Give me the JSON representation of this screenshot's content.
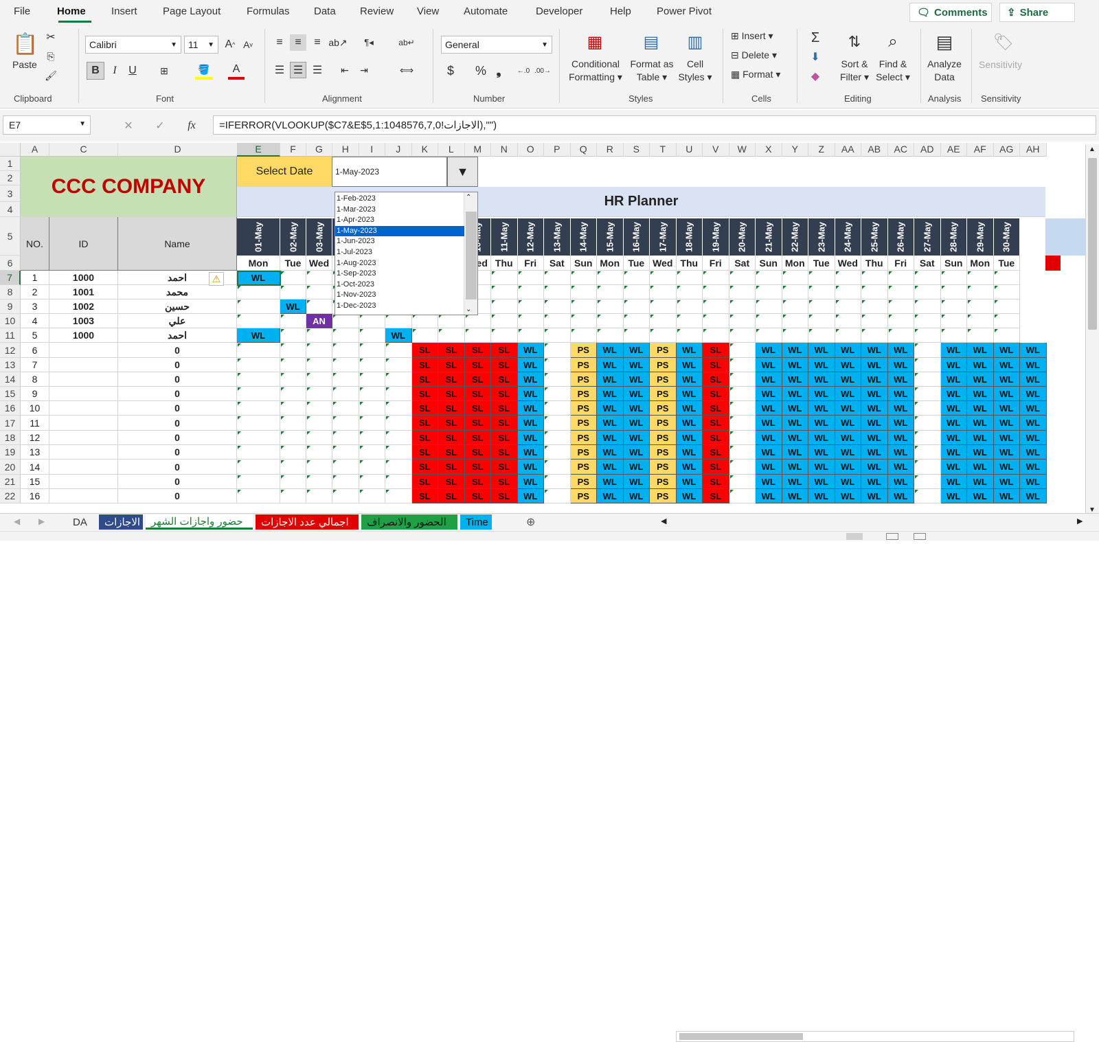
{
  "menu": {
    "items": [
      "File",
      "Home",
      "Insert",
      "Page Layout",
      "Formulas",
      "Data",
      "Review",
      "View",
      "Automate",
      "Developer",
      "Help",
      "Power Pivot"
    ],
    "comments": "Comments",
    "share": "Share"
  },
  "ribbon": {
    "paste": "Paste",
    "font_name": "Calibri",
    "font_size": "11",
    "number_format": "General",
    "conditional": "Conditional Formatting ▾",
    "format_table": "Format as Table ▾",
    "cell_styles": "Cell Styles ▾",
    "insert": "Insert",
    "delete": "Delete",
    "format": "Format",
    "sort_filter": "Sort & Filter ▾",
    "find_select": "Find & Select ▾",
    "analyze": "Analyze Data",
    "sensitivity": "Sensitivity",
    "groups": [
      "Clipboard",
      "Font",
      "Alignment",
      "Number",
      "Styles",
      "Cells",
      "Editing",
      "Analysis",
      "Sensitivity"
    ]
  },
  "formula_bar": {
    "name_box": "E7",
    "formula": "=IFERROR(VLOOKUP($C7&E$5,الاجازات!1:1048576,7,0),\"\")"
  },
  "columns": [
    "A",
    "C",
    "D",
    "E",
    "F",
    "G",
    "H",
    "I",
    "J",
    "K",
    "L",
    "M",
    "N",
    "O",
    "P",
    "Q",
    "R",
    "S",
    "T",
    "U",
    "V",
    "W",
    "X",
    "Y",
    "Z",
    "AA",
    "AB",
    "AC",
    "AD",
    "AE",
    "AF",
    "AG",
    "AH"
  ],
  "rows": [
    "1",
    "2",
    "3",
    "4",
    "5",
    "6",
    "7",
    "8",
    "9",
    "10",
    "11",
    "12",
    "13",
    "14",
    "15",
    "16",
    "17",
    "18",
    "19",
    "20",
    "21",
    "22"
  ],
  "sheet": {
    "company": "CCC COMPANY",
    "select_date_label": "Select Date",
    "selected_date": "1-May-2023",
    "planner_title": "HR Planner",
    "hdr_no": "NO.",
    "hdr_id": "ID",
    "hdr_name": "Name",
    "dates": [
      "01-May",
      "02-May",
      "03-May",
      "",
      "",
      "",
      "",
      "",
      "10-May",
      "11-May",
      "12-May",
      "13-May",
      "14-May",
      "15-May",
      "16-May",
      "17-May",
      "18-May",
      "19-May",
      "20-May",
      "21-May",
      "22-May",
      "23-May",
      "24-May",
      "25-May",
      "26-May",
      "27-May",
      "28-May",
      "29-May",
      "30-May"
    ],
    "days": [
      "Mon",
      "Tue",
      "Wed",
      "",
      "",
      "",
      "",
      "ue",
      "Wed",
      "Thu",
      "Fri",
      "Sat",
      "Sun",
      "Mon",
      "Tue",
      "Wed",
      "Thu",
      "Fri",
      "Sat",
      "Sun",
      "Mon",
      "Tue",
      "Wed",
      "Thu",
      "Fri",
      "Sat",
      "Sun",
      "Mon",
      "Tue"
    ],
    "employees": [
      {
        "no": "1",
        "id": "1000",
        "name": "احمد"
      },
      {
        "no": "2",
        "id": "1001",
        "name": "محمد"
      },
      {
        "no": "3",
        "id": "1002",
        "name": "حسين"
      },
      {
        "no": "4",
        "id": "1003",
        "name": "علي"
      },
      {
        "no": "5",
        "id": "1000",
        "name": "احمد"
      },
      {
        "no": "6",
        "id": "",
        "name": "0"
      },
      {
        "no": "7",
        "id": "",
        "name": "0"
      },
      {
        "no": "8",
        "id": "",
        "name": "0"
      },
      {
        "no": "9",
        "id": "",
        "name": "0"
      },
      {
        "no": "10",
        "id": "",
        "name": "0"
      },
      {
        "no": "11",
        "id": "",
        "name": "0"
      },
      {
        "no": "12",
        "id": "",
        "name": "0"
      },
      {
        "no": "13",
        "id": "",
        "name": "0"
      },
      {
        "no": "14",
        "id": "",
        "name": "0"
      },
      {
        "no": "15",
        "id": "",
        "name": "0"
      },
      {
        "no": "16",
        "id": "",
        "name": "0"
      }
    ],
    "leave_codes": {
      "WL": "#00b0f0",
      "SL": "#ff0000",
      "PS": "#ffd966",
      "AN": "#7030a0"
    },
    "dropdown_options": [
      "1-Feb-2023",
      "1-Mar-2023",
      "1-Apr-2023",
      "1-May-2023",
      "1-Jun-2023",
      "1-Jul-2023",
      "1-Aug-2023",
      "1-Sep-2023",
      "1-Oct-2023",
      "1-Nov-2023",
      "1-Dec-2023"
    ],
    "dropdown_selected": "1-May-2023"
  },
  "tabs": [
    {
      "label": "DA",
      "color": "#f3f3f3",
      "text": "#333"
    },
    {
      "label": "الاجازات",
      "color": "#2f4b8a",
      "text": "#fff"
    },
    {
      "label": "حضور واجازات الشهر",
      "color": "#ffffff",
      "text": "#1e7b34"
    },
    {
      "label": "اجمالي عدد الاجازات",
      "color": "#e00000",
      "text": "#fff"
    },
    {
      "label": "الحضور والانصراف",
      "color": "#1fa045",
      "text": "#111"
    },
    {
      "label": "Time",
      "color": "#00b0f0",
      "text": "#111"
    }
  ]
}
